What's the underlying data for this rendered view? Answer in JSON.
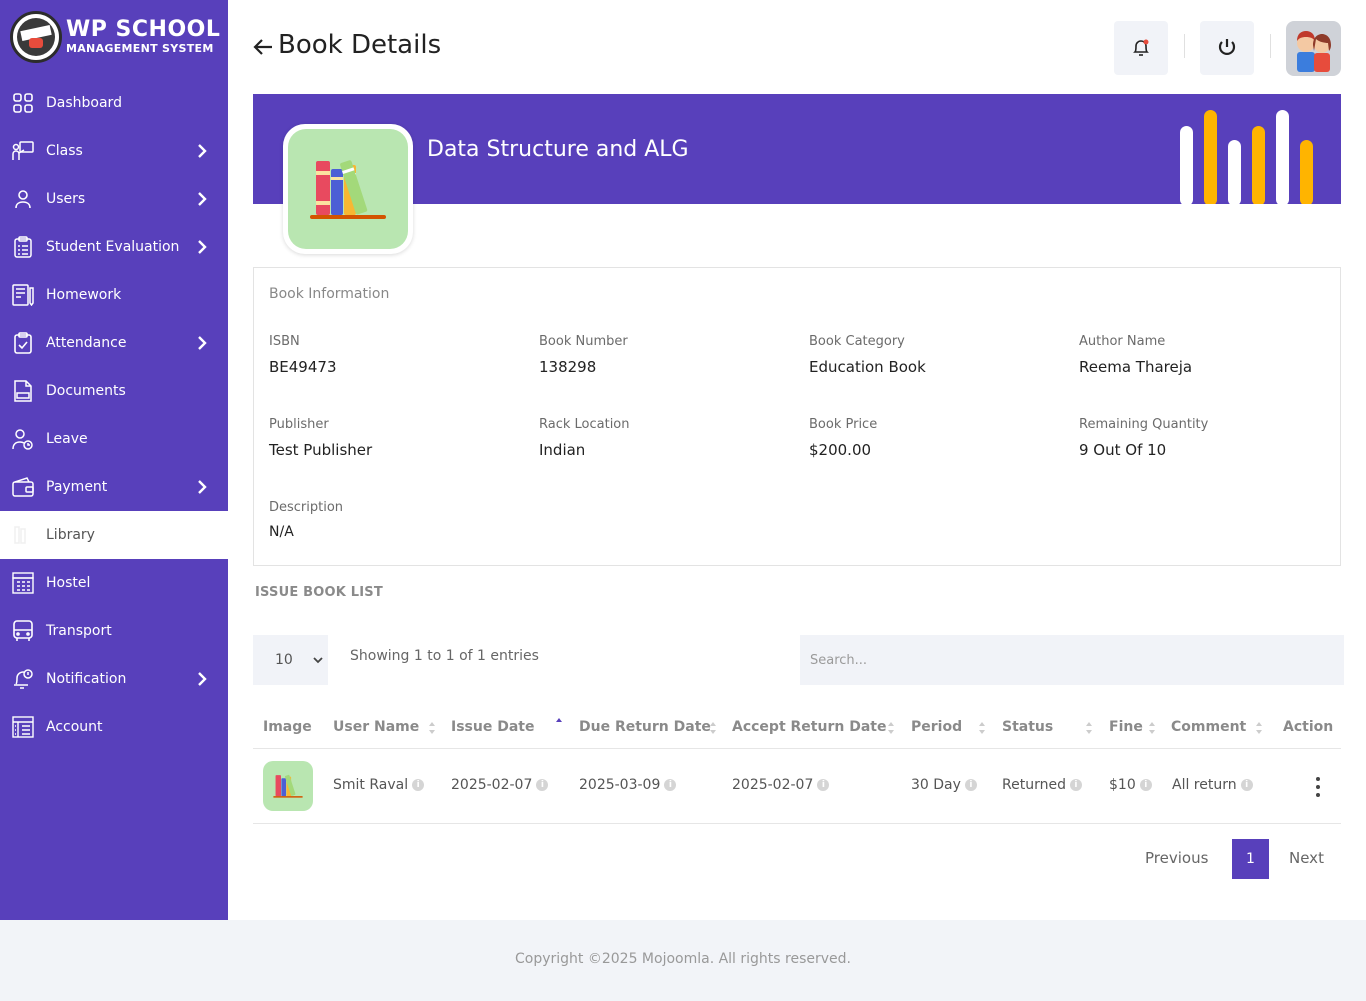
{
  "brand": {
    "title": "WP SCHOOL",
    "subtitle": "MANAGEMENT SYSTEM"
  },
  "sidebar": {
    "items": [
      {
        "label": "Dashboard",
        "icon": "grid-icon",
        "has_chevron": false
      },
      {
        "label": "Class",
        "icon": "teacher-board-icon",
        "has_chevron": true
      },
      {
        "label": "Users",
        "icon": "user-icon",
        "has_chevron": true
      },
      {
        "label": "Student Evaluation",
        "icon": "clipboard-icon",
        "has_chevron": true
      },
      {
        "label": "Homework",
        "icon": "homework-icon",
        "has_chevron": false
      },
      {
        "label": "Attendance",
        "icon": "check-calendar-icon",
        "has_chevron": true
      },
      {
        "label": "Documents",
        "icon": "document-icon",
        "has_chevron": false
      },
      {
        "label": "Leave",
        "icon": "leave-icon",
        "has_chevron": false
      },
      {
        "label": "Payment",
        "icon": "wallet-icon",
        "has_chevron": true
      },
      {
        "label": "Library",
        "icon": "library-icon",
        "has_chevron": false,
        "active": true
      },
      {
        "label": "Hostel",
        "icon": "hostel-icon",
        "has_chevron": false
      },
      {
        "label": "Transport",
        "icon": "bus-icon",
        "has_chevron": false
      },
      {
        "label": "Notification",
        "icon": "notification-icon",
        "has_chevron": true
      },
      {
        "label": "Account",
        "icon": "account-icon",
        "has_chevron": false
      }
    ]
  },
  "header": {
    "title": "Book Details",
    "back_icon": "arrow-left-icon",
    "bell_icon": "bell-icon",
    "power_icon": "power-icon"
  },
  "banner": {
    "book_title": "Data Structure and ALG"
  },
  "book_info": {
    "heading": "Book Information",
    "isbn_label": "ISBN",
    "isbn": "BE49473",
    "book_number_label": "Book Number",
    "book_number": "138298",
    "category_label": "Book Category",
    "category": "Education Book",
    "author_label": "Author Name",
    "author": "Reema Thareja",
    "publisher_label": "Publisher",
    "publisher": "Test Publisher",
    "rack_label": "Rack Location",
    "rack": "Indian",
    "price_label": "Book Price",
    "price": "$200.00",
    "remaining_label": "Remaining Quantity",
    "remaining": "9 Out Of 10",
    "description_label": "Description",
    "description": "N/A"
  },
  "issue_list": {
    "title": "ISSUE BOOK LIST",
    "page_length": "10",
    "showing": "Showing 1 to 1 of 1 entries",
    "search_placeholder": "Search...",
    "columns": [
      "Image",
      "User Name",
      "Issue Date",
      "Due Return Date",
      "Accept Return Date",
      "Period",
      "Status",
      "Fine",
      "Comment",
      "Action"
    ],
    "rows": [
      {
        "user_name": "Smit Raval",
        "issue_date": "2025-02-07",
        "due_return_date": "2025-03-09",
        "accept_return_date": "2025-02-07",
        "period": "30 Day",
        "status": "Returned",
        "fine": "$10",
        "comment": "All return"
      }
    ],
    "pagination": {
      "previous": "Previous",
      "current": "1",
      "next": "Next"
    }
  },
  "footer": {
    "text": "Copyright ©2025 Mojoomla. All rights reserved."
  },
  "colors": {
    "primary": "#5840bb",
    "accent_bar": "#ffb400",
    "book_bg": "#b9e6b1"
  }
}
